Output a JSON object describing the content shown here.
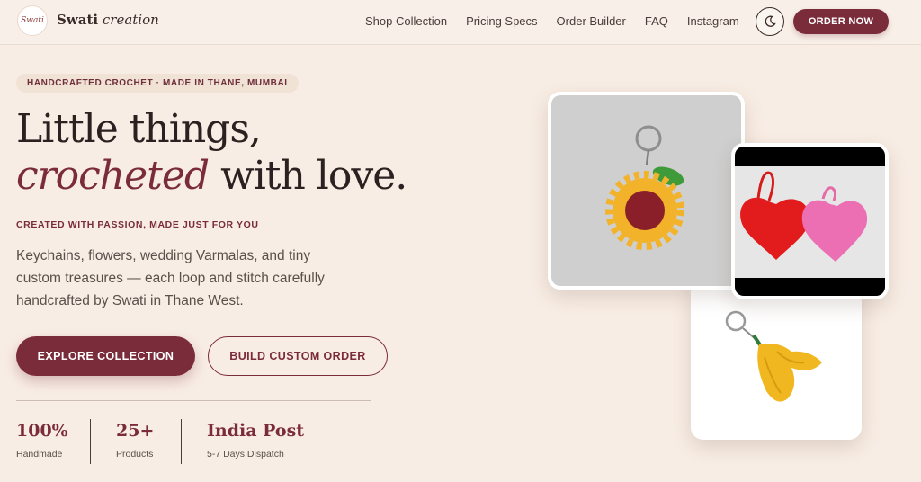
{
  "nav": {
    "logo_text": "Swati",
    "brand_bold": "Swati",
    "brand_italic": "creation",
    "links": [
      "Shop Collection",
      "Pricing Specs",
      "Order Builder",
      "FAQ",
      "Instagram"
    ],
    "theme_icon": "moon-icon",
    "order_label": "ORDER NOW"
  },
  "hero": {
    "pill": "HANDCRAFTED CROCHET · MADE IN THANE, MUMBAI",
    "title_line1": "Little things,",
    "title_em": "crocheted",
    "title_rest": " with love.",
    "tagline": "CREATED WITH PASSION, MADE JUST FOR YOU",
    "description": "Keychains, flowers, wedding Varmalas, and tiny custom treasures — each loop and stitch carefully handcrafted by Swati in Thane West.",
    "primary_btn": "EXPLORE COLLECTION",
    "secondary_btn": "BUILD CUSTOM ORDER"
  },
  "stats": [
    {
      "value": "100%",
      "label": "Handmade"
    },
    {
      "value": "25+",
      "label": "Products"
    },
    {
      "value": "India Post",
      "label": "5-7 Days Dispatch"
    }
  ],
  "colors": {
    "accent": "#7a2c3a",
    "background": "#f8ede4"
  }
}
